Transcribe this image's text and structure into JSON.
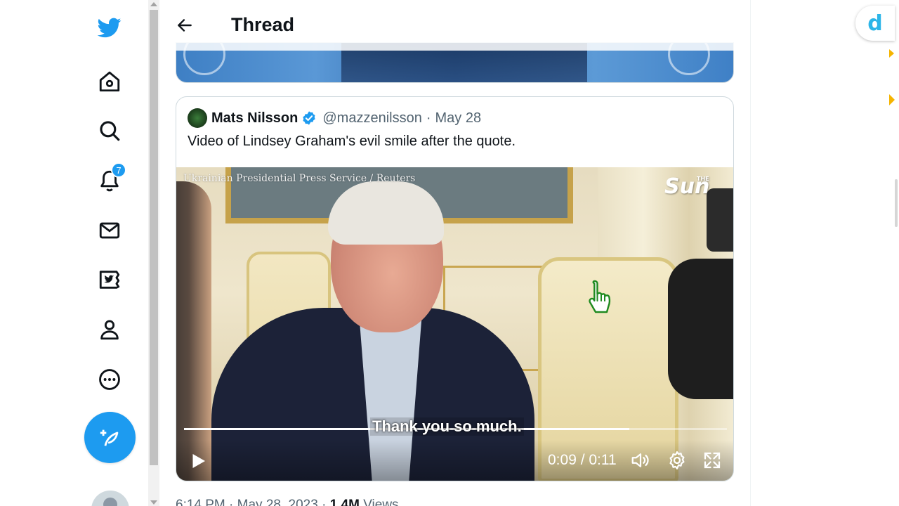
{
  "app": {
    "name": "Twitter",
    "accent_color": "#1d9bf0"
  },
  "nav": {
    "items": [
      {
        "name": "home",
        "icon": "home-icon"
      },
      {
        "name": "explore",
        "icon": "search-icon"
      },
      {
        "name": "notifications",
        "icon": "bell-icon",
        "badge": "7"
      },
      {
        "name": "messages",
        "icon": "mail-icon"
      },
      {
        "name": "twitter-blue",
        "icon": "twitter-blue-icon"
      },
      {
        "name": "profile",
        "icon": "person-icon"
      },
      {
        "name": "more",
        "icon": "more-circle-icon"
      }
    ],
    "compose_icon": "compose-feather-icon"
  },
  "header": {
    "title": "Thread",
    "back_icon": "arrow-left-icon"
  },
  "quote_tweet": {
    "author_name": "Mats Nilsson",
    "verified": true,
    "handle": "@mazzenilsson",
    "separator": "·",
    "date": "May 28",
    "text": "Video of Lindsey Graham's evil smile after the quote."
  },
  "video": {
    "credit": "Ukrainian Presidential Press Service / Reuters",
    "logo": "Sun",
    "logo_small": "THE",
    "caption": "Thank you so much.",
    "time": "0:09 / 0:11",
    "progress": 0.82
  },
  "tweet_meta": {
    "time": "6:14 PM",
    "separator": "·",
    "date": "May 28, 2023",
    "views_count": "1.4M",
    "views_label": "Views"
  },
  "extension": {
    "letter": "d",
    "color": "#2cb5e8"
  }
}
